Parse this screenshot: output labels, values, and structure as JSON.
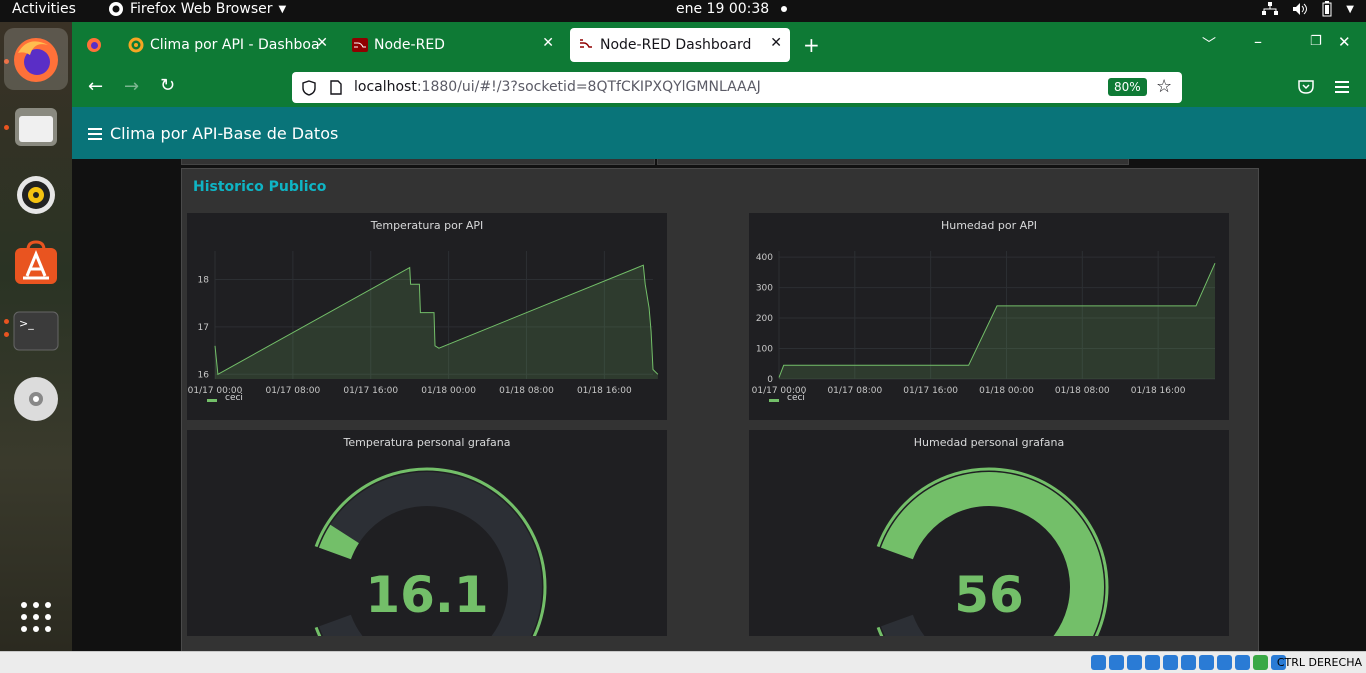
{
  "topbar": {
    "activities": "Activities",
    "app_name": "Firefox Web Browser",
    "clock": "ene 19  00:38"
  },
  "browser": {
    "tabs": [
      {
        "label": "Clima por API - Dashboard",
        "icon": "grafana-icon"
      },
      {
        "label": "Node-RED",
        "icon": "node-red-icon"
      },
      {
        "label": "Node-RED Dashboard",
        "icon": "node-red-icon"
      }
    ],
    "url_host": "localhost",
    "url_rest": ":1880/ui/#!/3?socketid=8QTfCKIPXQYlGMNLAAAJ",
    "zoom": "80%"
  },
  "dashboard": {
    "title": "Clima por API-Base de Datos",
    "group_title": "Historico Publico"
  },
  "panels": {
    "temp_api": {
      "title": "Temperatura por API",
      "legend": "ceci",
      "color": "#73bf69"
    },
    "hum_api": {
      "title": "Humedad por API",
      "legend": "ceci",
      "color": "#73bf69"
    },
    "temp_gauge": {
      "title": "Temperatura personal grafana",
      "value": "16.1"
    },
    "hum_gauge": {
      "title": "Humedad personal grafana",
      "value": "56"
    }
  },
  "chart_data": [
    {
      "type": "area",
      "title": "Temperatura por API",
      "x_ticks": [
        "01/17 00:00",
        "01/17 08:00",
        "01/17 16:00",
        "01/18 00:00",
        "01/18 08:00",
        "01/18 16:00"
      ],
      "y_ticks": [
        16,
        17,
        18
      ],
      "ylim": [
        15.9,
        18.6
      ],
      "xlim_hours": [
        0,
        45
      ],
      "series": [
        {
          "name": "ceci",
          "points": [
            [
              0,
              16.6
            ],
            [
              0.3,
              16.0
            ],
            [
              20,
              18.25
            ],
            [
              20.1,
              17.9
            ],
            [
              21,
              17.9
            ],
            [
              21.1,
              17.3
            ],
            [
              22.5,
              17.3
            ],
            [
              22.6,
              16.6
            ],
            [
              23,
              16.55
            ],
            [
              44,
              18.3
            ],
            [
              44.2,
              17.9
            ],
            [
              44.6,
              17.4
            ],
            [
              44.8,
              16.9
            ],
            [
              45,
              16.1
            ],
            [
              45.5,
              16.0
            ]
          ]
        }
      ],
      "grid": true,
      "legend_position": "bottom-left"
    },
    {
      "type": "area",
      "title": "Humedad por API",
      "x_ticks": [
        "01/17 00:00",
        "01/17 08:00",
        "01/17 16:00",
        "01/18 00:00",
        "01/18 08:00",
        "01/18 16:00"
      ],
      "y_ticks": [
        0,
        100,
        200,
        300,
        400
      ],
      "ylim": [
        0,
        420
      ],
      "xlim_hours": [
        0,
        46
      ],
      "series": [
        {
          "name": "ceci",
          "points": [
            [
              0,
              5
            ],
            [
              0.5,
              45
            ],
            [
              20,
              45
            ],
            [
              23,
              240
            ],
            [
              44,
              240
            ],
            [
              46,
              380
            ]
          ]
        }
      ],
      "grid": true,
      "legend_position": "bottom-left"
    },
    {
      "type": "gauge",
      "title": "Temperatura personal grafana",
      "value": 16.1,
      "fill_fraction": 0.04
    },
    {
      "type": "gauge",
      "title": "Humedad personal grafana",
      "value": 56,
      "fill_fraction": 0.82
    }
  ]
}
